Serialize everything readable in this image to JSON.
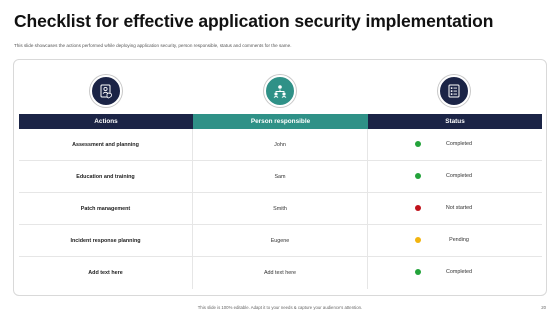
{
  "title": "Checklist for effective application security implementation",
  "subtitle": "This slide showcases the actions performed while deploying application security, person responsible, status and comments for the same.",
  "icons": [
    "security-checklist-icon",
    "team-icon",
    "status-list-icon"
  ],
  "colors": {
    "navy": "#1b2446",
    "teal": "#2f9187",
    "completed": "#23a33a",
    "not_started": "#c0121b",
    "pending": "#f2b40f"
  },
  "table": {
    "headers": [
      "Actions",
      "Person responsible",
      "Status"
    ],
    "rows": [
      {
        "action": "Assessment and planning",
        "person": "John",
        "status": "Completed",
        "status_color": "#23a33a"
      },
      {
        "action": "Education and training",
        "person": "Sam",
        "status": "Completed",
        "status_color": "#23a33a"
      },
      {
        "action": "Patch management",
        "person": "Smith",
        "status": "Not started",
        "status_color": "#c0121b"
      },
      {
        "action": "Incident response planning",
        "person": "Eugene",
        "status": "Pending",
        "status_color": "#f2b40f"
      },
      {
        "action": "Add text here",
        "person": "Add text here",
        "status": "Completed",
        "status_color": "#23a33a"
      }
    ]
  },
  "footer": "This slide is 100% editable. Adapt it to your needs & capture your audience's attention.",
  "page_number": "20"
}
